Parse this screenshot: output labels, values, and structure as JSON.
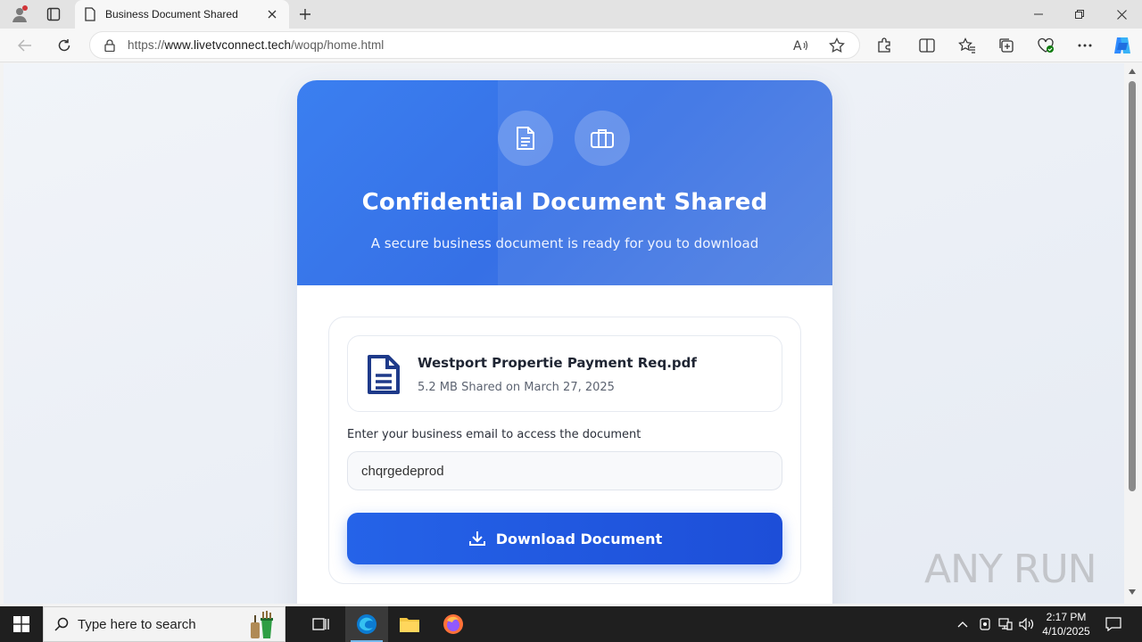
{
  "browser": {
    "tab_title": "Business Document Shared",
    "url_scheme": "https://",
    "url_host": "www.livetvconnect.tech",
    "url_path": "/woqp/home.html"
  },
  "hero": {
    "title": "Confidential Document Shared",
    "subtitle": "A secure business document is ready for you to download"
  },
  "file": {
    "name": "Westport Propertie Payment Req.pdf",
    "meta": "5.2 MB Shared on March 27, 2025"
  },
  "form": {
    "email_label": "Enter your business email to access the document",
    "email_value": "chqrgedeprod",
    "download_label": "Download Document"
  },
  "watermark": "ANY RUN",
  "taskbar": {
    "search_placeholder": "Type here to search",
    "time": "2:17 PM",
    "date": "4/10/2025"
  },
  "colors": {
    "accent": "#2563e8",
    "hero": "#3b7ff0",
    "file_icon": "#1e3a8a"
  }
}
